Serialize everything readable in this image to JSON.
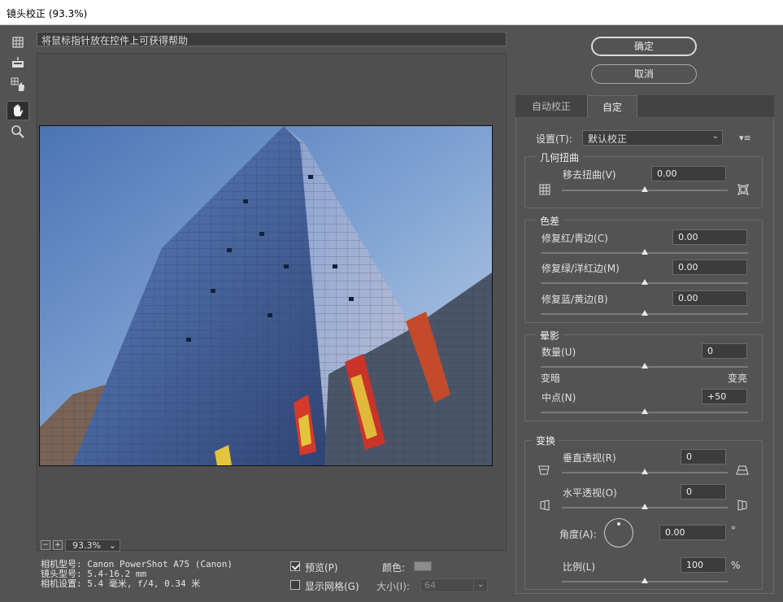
{
  "window": {
    "title": "镜头校正 (93.3%)"
  },
  "toolbar": {
    "tools": [
      "remove-distortion-tool",
      "straighten-tool",
      "move-grid-tool",
      "hand-tool",
      "zoom-tool"
    ],
    "active": "hand-tool"
  },
  "hint": {
    "text": "将鼠标指针放在控件上可获得帮助"
  },
  "zoom": {
    "value": "93.3%"
  },
  "camera": {
    "model": "相机型号: Canon PowerShot A75 (Canon)",
    "lens": "镜头型号: 5.4-16.2 mm",
    "settings": "相机设置: 5.4 毫米, f/4, 0.34 米"
  },
  "options": {
    "preview_label": "预览(P)",
    "preview_checked": true,
    "grid_label": "显示网格(G)",
    "grid_checked": false,
    "color_label": "颜色:",
    "color_value": "#8c8c8c",
    "size_label": "大小(I):",
    "size_value": "64"
  },
  "buttons": {
    "ok": "确定",
    "cancel": "取消"
  },
  "tabs": {
    "auto": "自动校正",
    "custom": "自定"
  },
  "settings": {
    "label": "设置(T):",
    "value": "默认校正"
  },
  "geometric": {
    "title": "几何扭曲",
    "remove_distortion": {
      "label": "移去扭曲(V)",
      "value": "0.00"
    }
  },
  "chromatic": {
    "title": "色差",
    "red_cyan": {
      "label": "修复红/青边(C)",
      "value": "0.00"
    },
    "green_magenta": {
      "label": "修复绿/洋红边(M)",
      "value": "0.00"
    },
    "blue_yellow": {
      "label": "修复蓝/黄边(B)",
      "value": "0.00"
    }
  },
  "vignette": {
    "title": "晕影",
    "amount": {
      "label": "数量(U)",
      "value": "0"
    },
    "darken_label": "变暗",
    "lighten_label": "变亮",
    "midpoint": {
      "label": "中点(N)",
      "value": "+50"
    }
  },
  "transform": {
    "title": "变换",
    "vertical": {
      "label": "垂直透视(R)",
      "value": "0"
    },
    "horizontal": {
      "label": "水平透视(O)",
      "value": "0"
    },
    "angle": {
      "label": "角度(A):",
      "value": "0.00",
      "unit": "°"
    },
    "scale": {
      "label": "比例(L)",
      "value": "100",
      "unit": "%"
    }
  }
}
